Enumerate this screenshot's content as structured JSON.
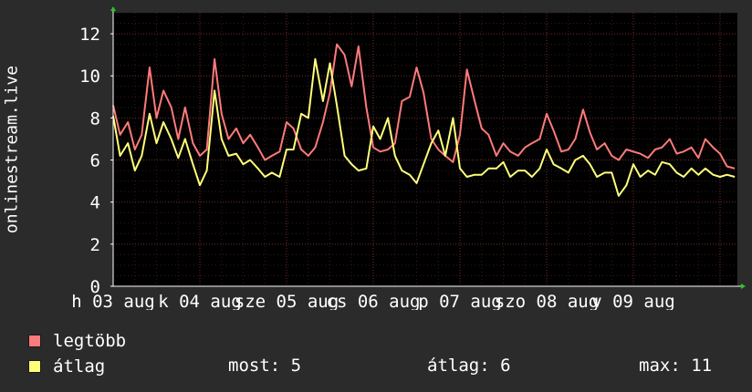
{
  "chart_data": {
    "type": "line",
    "ylabel": "onlinestream.live",
    "ylim": [
      0,
      13
    ],
    "yticks": [
      0,
      2,
      4,
      6,
      8,
      10,
      12
    ],
    "xlim": [
      0,
      7.2
    ],
    "xtick_labels": [
      {
        "label": "h 03 aug",
        "pos": 0
      },
      {
        "label": "k 04 aug",
        "pos": 1
      },
      {
        "label": "sze 05 aug",
        "pos": 2
      },
      {
        "label": "cs 06 aug",
        "pos": 3
      },
      {
        "label": "p 07 aug",
        "pos": 4
      },
      {
        "label": "szo 08 aug",
        "pos": 5
      },
      {
        "label": "v 09 aug",
        "pos": 6
      }
    ],
    "grid": true,
    "series": [
      {
        "name": "legtöbb",
        "color": "#ff7a7a",
        "x": [
          0.0,
          0.08,
          0.17,
          0.25,
          0.33,
          0.42,
          0.5,
          0.58,
          0.67,
          0.75,
          0.83,
          0.92,
          1.0,
          1.08,
          1.17,
          1.25,
          1.33,
          1.42,
          1.5,
          1.58,
          1.67,
          1.75,
          1.83,
          1.92,
          2.0,
          2.08,
          2.17,
          2.25,
          2.33,
          2.42,
          2.5,
          2.58,
          2.67,
          2.75,
          2.83,
          2.92,
          3.0,
          3.08,
          3.17,
          3.25,
          3.33,
          3.42,
          3.5,
          3.58,
          3.67,
          3.75,
          3.83,
          3.92,
          4.0,
          4.08,
          4.17,
          4.25,
          4.33,
          4.42,
          4.5,
          4.58,
          4.67,
          4.75,
          4.83,
          4.92,
          5.0,
          5.08,
          5.17,
          5.25,
          5.33,
          5.42,
          5.5,
          5.58,
          5.67,
          5.75,
          5.83,
          5.92,
          6.0,
          6.08,
          6.17,
          6.25,
          6.33,
          6.42,
          6.5,
          6.58,
          6.67,
          6.75,
          6.83,
          6.92,
          7.0,
          7.08,
          7.17
        ],
        "values": [
          8.6,
          7.2,
          7.8,
          6.5,
          7.2,
          10.4,
          8.0,
          9.3,
          8.5,
          7.0,
          8.5,
          6.8,
          6.2,
          6.5,
          10.8,
          8.2,
          7.0,
          7.5,
          6.8,
          7.2,
          6.6,
          6.0,
          6.2,
          6.4,
          7.8,
          7.5,
          6.5,
          6.2,
          6.6,
          7.8,
          9.2,
          11.5,
          11.0,
          9.5,
          11.4,
          8.5,
          6.6,
          6.4,
          6.5,
          6.8,
          8.8,
          9.0,
          10.4,
          9.2,
          7.0,
          6.5,
          6.2,
          5.9,
          7.2,
          10.3,
          8.8,
          7.5,
          7.2,
          6.2,
          6.8,
          6.4,
          6.2,
          6.6,
          6.8,
          7.0,
          8.2,
          7.4,
          6.4,
          6.5,
          7.0,
          8.4,
          7.3,
          6.5,
          6.8,
          6.2,
          6.0,
          6.5,
          6.4,
          6.3,
          6.1,
          6.5,
          6.6,
          7.0,
          6.3,
          6.4,
          6.6,
          6.1,
          7.0,
          6.6,
          6.3,
          5.7,
          5.6
        ]
      },
      {
        "name": "átlag",
        "color": "#ffff7a",
        "x": [
          0.0,
          0.08,
          0.17,
          0.25,
          0.33,
          0.42,
          0.5,
          0.58,
          0.67,
          0.75,
          0.83,
          0.92,
          1.0,
          1.08,
          1.17,
          1.25,
          1.33,
          1.42,
          1.5,
          1.58,
          1.67,
          1.75,
          1.83,
          1.92,
          2.0,
          2.08,
          2.17,
          2.25,
          2.33,
          2.42,
          2.5,
          2.58,
          2.67,
          2.75,
          2.83,
          2.92,
          3.0,
          3.08,
          3.17,
          3.25,
          3.33,
          3.42,
          3.5,
          3.58,
          3.67,
          3.75,
          3.83,
          3.92,
          4.0,
          4.08,
          4.17,
          4.25,
          4.33,
          4.42,
          4.5,
          4.58,
          4.67,
          4.75,
          4.83,
          4.92,
          5.0,
          5.08,
          5.17,
          5.25,
          5.33,
          5.42,
          5.5,
          5.58,
          5.67,
          5.75,
          5.83,
          5.92,
          6.0,
          6.08,
          6.17,
          6.25,
          6.33,
          6.42,
          6.5,
          6.58,
          6.67,
          6.75,
          6.83,
          6.92,
          7.0,
          7.08,
          7.17
        ],
        "values": [
          8.1,
          6.2,
          6.8,
          5.5,
          6.2,
          8.2,
          6.8,
          7.8,
          7.0,
          6.1,
          7.0,
          5.8,
          4.8,
          5.5,
          9.3,
          7.0,
          6.2,
          6.3,
          5.8,
          6.0,
          5.6,
          5.2,
          5.4,
          5.2,
          6.5,
          6.5,
          8.2,
          8.0,
          10.8,
          8.8,
          10.6,
          8.6,
          6.2,
          5.8,
          5.5,
          5.6,
          7.6,
          7.0,
          8.0,
          6.2,
          5.5,
          5.3,
          4.9,
          5.8,
          6.8,
          7.4,
          6.2,
          8.0,
          5.6,
          5.2,
          5.3,
          5.3,
          5.6,
          5.6,
          5.9,
          5.2,
          5.5,
          5.5,
          5.2,
          5.6,
          6.5,
          5.8,
          5.6,
          5.4,
          6.0,
          6.2,
          5.8,
          5.2,
          5.4,
          5.4,
          4.3,
          4.8,
          5.8,
          5.2,
          5.5,
          5.3,
          5.9,
          5.8,
          5.4,
          5.2,
          5.6,
          5.3,
          5.6,
          5.3,
          5.2,
          5.3,
          5.2
        ]
      }
    ]
  },
  "legend": [
    {
      "label": "legtöbb",
      "color": "#ff7a7a"
    },
    {
      "label": "átlag",
      "color": "#ffff7a"
    }
  ],
  "stats": {
    "now": "most: 5",
    "avg": "átlag: 6",
    "max": "max: 11"
  },
  "colors": {
    "background": "#2b2b2b",
    "plot_background": "#000000",
    "grid": "#5a2020",
    "axis": "#ffffff"
  }
}
